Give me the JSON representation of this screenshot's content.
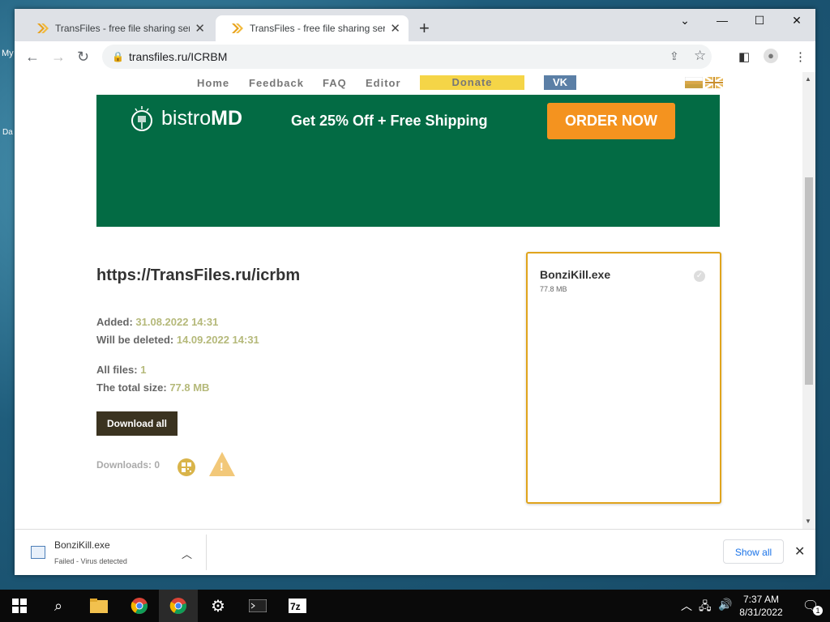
{
  "desktop": {
    "icon_labels": [
      "My",
      "Da"
    ]
  },
  "browser": {
    "tabs": [
      {
        "title": "TransFiles - free file sharing servi",
        "active": false
      },
      {
        "title": "TransFiles - free file sharing servi",
        "active": true
      }
    ],
    "url": "transfiles.ru/ICRBM"
  },
  "site": {
    "nav": [
      "Home",
      "Feedback",
      "FAQ",
      "Editor"
    ],
    "donate": "Donate",
    "vk": "VK",
    "ad": {
      "brand": "bistro",
      "brand_bold": "MD",
      "text": "Get 25% Off + Free Shipping",
      "cta": "ORDER NOW",
      "color": "#036b44"
    },
    "file_url": "https://TransFiles.ru/icrbm",
    "added_label": "Added:",
    "added_value": "31.08.2022 14:31",
    "deleted_label": "Will be deleted:",
    "deleted_value": "14.09.2022 14:31",
    "files_label": "All files:",
    "files_value": "1",
    "size_label": "The total size:",
    "size_value": "77.8 MB",
    "download_all": "Download all",
    "downloads_label": "Downloads: 0",
    "file": {
      "name": "BonziKill.exe",
      "size": "77.8 MB"
    }
  },
  "shelf": {
    "file_name": "BonziKill.exe",
    "status": "Failed - Virus detected",
    "show_all": "Show all"
  },
  "taskbar": {
    "time": "7:37 AM",
    "date": "8/31/2022",
    "notifications": "1"
  }
}
